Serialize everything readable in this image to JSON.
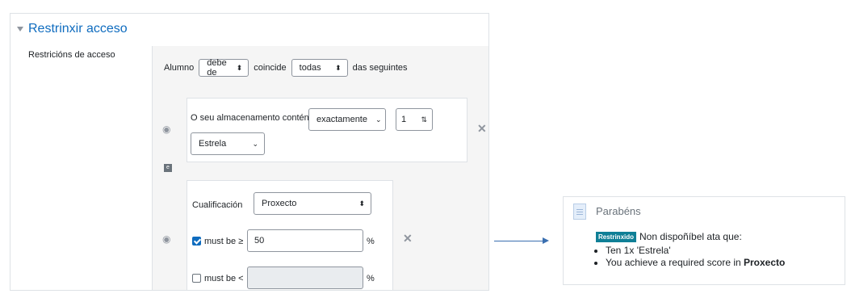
{
  "section": {
    "title": "Restrinxir acceso",
    "field_label": "Restricións de acceso"
  },
  "root": {
    "prefix": "Alumno",
    "must_select": "debe de",
    "match_text": "coincide",
    "all_select": "todas",
    "suffix": "das seguintes"
  },
  "cond1": {
    "label": "O seu almacenamento contén",
    "operator": "exactamente",
    "quantity": "1",
    "item": "Estrela"
  },
  "separator": {
    "badge": "e"
  },
  "cond2": {
    "label": "Cualificación",
    "grade_item": "Proxecto",
    "min_label": "must be ≥",
    "min_checked": true,
    "min_value": "50",
    "min_unit": "%",
    "max_label": "must be <",
    "max_checked": false,
    "max_value": "",
    "max_unit": "%"
  },
  "card": {
    "title": "Parabéns",
    "badge": "Restrinxido",
    "intro": "Non dispoñíbel ata que:",
    "items": [
      {
        "text": "Ten 1x 'Estrela'",
        "bold": ""
      },
      {
        "text": "You achieve a required score in ",
        "bold": "Proxecto"
      }
    ]
  },
  "icons": [
    "chevron-down-icon",
    "eye-icon",
    "close-icon",
    "document-icon",
    "arrow-right-icon",
    "select-arrow-icon",
    "spinner-icon"
  ],
  "colors": {
    "link": "#0f6cbf",
    "badge": "#0f7f96",
    "area_bg": "#f5f5f5",
    "arrow": "#3a6fb0"
  }
}
